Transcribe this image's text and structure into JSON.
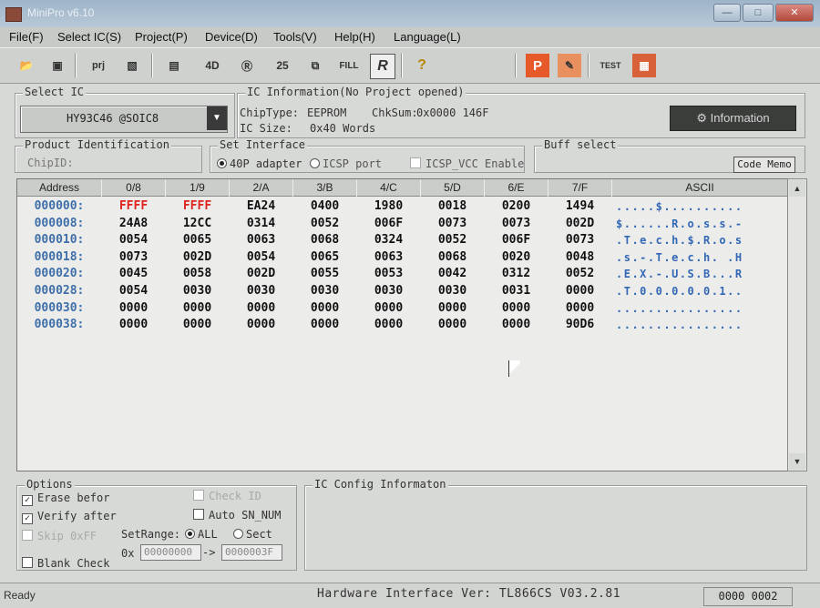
{
  "window": {
    "title": "MiniPro v6.10"
  },
  "menu": [
    "File(F)",
    "Select IC(S)",
    "Project(P)",
    "Device(D)",
    "Tools(V)",
    "Help(H)",
    "Language(L)"
  ],
  "toolbar": {
    "prj_label": "prj",
    "read_label": "R",
    "fill_label": "FILL",
    "p_label": "P",
    "test_label": "TEST"
  },
  "select_ic": {
    "title": "Select IC",
    "value": "HY93C46 @SOIC8"
  },
  "ic_info": {
    "title": "IC Information(No Project opened)",
    "chip_type_label": "ChipType:",
    "chip_type": "EEPROM",
    "chksum_label": "ChkSum:",
    "chksum": "0x0000 146F",
    "ic_size_label": "IC Size:",
    "ic_size": "0x40 Words",
    "info_button": "Information"
  },
  "product_id": {
    "title": "Product Identification",
    "chip_id_label": "ChipID:"
  },
  "set_interface": {
    "title": "Set Interface",
    "opt1": "40P adapter",
    "opt2": "ICSP port",
    "icsp_vcc": "ICSP_VCC Enable"
  },
  "buff_select": {
    "title": "Buff select",
    "code_memo": "Code Memo"
  },
  "grid": {
    "headers": [
      "Address",
      "0/8",
      "1/9",
      "2/A",
      "3/B",
      "4/C",
      "5/D",
      "6/E",
      "7/F",
      "ASCII"
    ],
    "rows": [
      {
        "addr": "000000:",
        "cells": [
          "FFFF",
          "FFFF",
          "EA24",
          "0400",
          "1980",
          "0018",
          "0200",
          "1494"
        ],
        "ascii": ".....$.........."
      },
      {
        "addr": "000008:",
        "cells": [
          "24A8",
          "12CC",
          "0314",
          "0052",
          "006F",
          "0073",
          "0073",
          "002D"
        ],
        "ascii": "$......R.o.s.s.-"
      },
      {
        "addr": "000010:",
        "cells": [
          "0054",
          "0065",
          "0063",
          "0068",
          "0324",
          "0052",
          "006F",
          "0073"
        ],
        "ascii": ".T.e.c.h.$.R.o.s"
      },
      {
        "addr": "000018:",
        "cells": [
          "0073",
          "002D",
          "0054",
          "0065",
          "0063",
          "0068",
          "0020",
          "0048"
        ],
        "ascii": ".s.-.T.e.c.h. .H"
      },
      {
        "addr": "000020:",
        "cells": [
          "0045",
          "0058",
          "002D",
          "0055",
          "0053",
          "0042",
          "0312",
          "0052"
        ],
        "ascii": ".E.X.-.U.S.B...R"
      },
      {
        "addr": "000028:",
        "cells": [
          "0054",
          "0030",
          "0030",
          "0030",
          "0030",
          "0030",
          "0031",
          "0000"
        ],
        "ascii": ".T.0.0.0.0.0.1.."
      },
      {
        "addr": "000030:",
        "cells": [
          "0000",
          "0000",
          "0000",
          "0000",
          "0000",
          "0000",
          "0000",
          "0000"
        ],
        "ascii": "................"
      },
      {
        "addr": "000038:",
        "cells": [
          "0000",
          "0000",
          "0000",
          "0000",
          "0000",
          "0000",
          "0000",
          "90D6"
        ],
        "ascii": "................"
      }
    ]
  },
  "options": {
    "title": "Options",
    "erase_before": "Erase befor",
    "verify_after": "Verify after",
    "skip_0xff": "Skip 0xFF",
    "blank_check": "Blank Check",
    "check_id": "Check ID",
    "auto_sn": "Auto SN_NUM",
    "set_range_label": "SetRange:",
    "range_all": "ALL",
    "range_sect": "Sect",
    "ox_label": "0x",
    "range_from": "00000000",
    "arrow": "->",
    "range_to": "0000003F"
  },
  "ic_config": {
    "title": "IC Config Informaton"
  },
  "status": {
    "left": "Ready",
    "center": "Hardware Interface Ver: TL866CS V03.2.81",
    "right": "0000 0002"
  },
  "colors": {
    "addr_blue": "#3e6ea8",
    "red_value": "#e0221e",
    "ascii_blue": "#3367b5"
  }
}
